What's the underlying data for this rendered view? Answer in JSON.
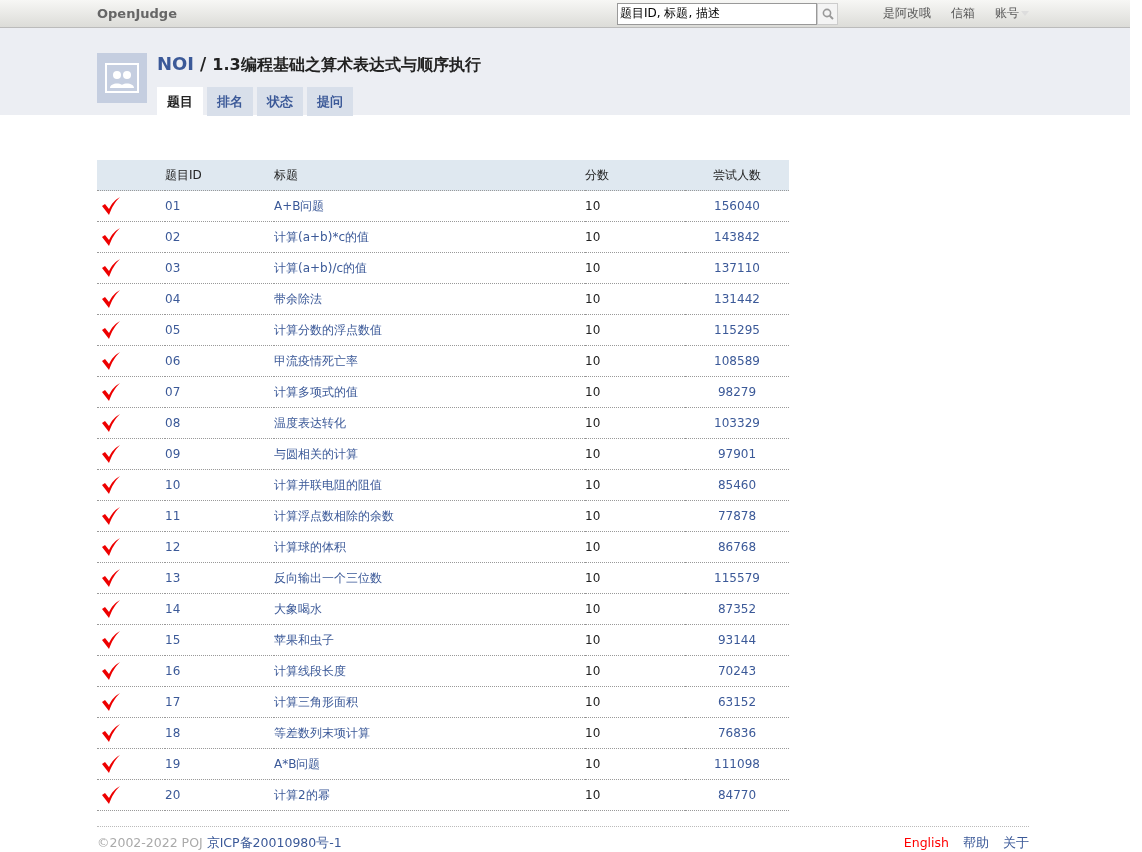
{
  "topbar": {
    "brand": "OpenJudge",
    "search": {
      "value": "题目ID, 标题, 描述"
    },
    "links": [
      {
        "label": "是阿改哦"
      },
      {
        "label": "信箱"
      },
      {
        "label": "账号",
        "dropdown": true
      }
    ]
  },
  "header": {
    "group": "NOI",
    "separator": "/",
    "title": "1.3编程基础之算术表达式与顺序执行",
    "tabs": [
      {
        "label": "题目",
        "selected": true
      },
      {
        "label": "排名",
        "selected": false
      },
      {
        "label": "状态",
        "selected": false
      },
      {
        "label": "提问",
        "selected": false
      }
    ]
  },
  "table": {
    "columns": [
      "题目ID",
      "标题",
      "分数",
      "尝试人数"
    ],
    "rows": [
      {
        "solved": true,
        "id": "01",
        "title": "A+B问题",
        "score": "10",
        "attempts": "156040"
      },
      {
        "solved": true,
        "id": "02",
        "title": "计算(a+b)*c的值",
        "score": "10",
        "attempts": "143842"
      },
      {
        "solved": true,
        "id": "03",
        "title": "计算(a+b)/c的值",
        "score": "10",
        "attempts": "137110"
      },
      {
        "solved": true,
        "id": "04",
        "title": "带余除法",
        "score": "10",
        "attempts": "131442"
      },
      {
        "solved": true,
        "id": "05",
        "title": "计算分数的浮点数值",
        "score": "10",
        "attempts": "115295"
      },
      {
        "solved": true,
        "id": "06",
        "title": "甲流疫情死亡率",
        "score": "10",
        "attempts": "108589"
      },
      {
        "solved": true,
        "id": "07",
        "title": "计算多项式的值",
        "score": "10",
        "attempts": "98279"
      },
      {
        "solved": true,
        "id": "08",
        "title": "温度表达转化",
        "score": "10",
        "attempts": "103329"
      },
      {
        "solved": true,
        "id": "09",
        "title": "与圆相关的计算",
        "score": "10",
        "attempts": "97901"
      },
      {
        "solved": true,
        "id": "10",
        "title": "计算并联电阻的阻值",
        "score": "10",
        "attempts": "85460"
      },
      {
        "solved": true,
        "id": "11",
        "title": "计算浮点数相除的余数",
        "score": "10",
        "attempts": "77878"
      },
      {
        "solved": true,
        "id": "12",
        "title": "计算球的体积",
        "score": "10",
        "attempts": "86768"
      },
      {
        "solved": true,
        "id": "13",
        "title": "反向输出一个三位数",
        "score": "10",
        "attempts": "115579"
      },
      {
        "solved": true,
        "id": "14",
        "title": "大象喝水",
        "score": "10",
        "attempts": "87352"
      },
      {
        "solved": true,
        "id": "15",
        "title": "苹果和虫子",
        "score": "10",
        "attempts": "93144"
      },
      {
        "solved": true,
        "id": "16",
        "title": "计算线段长度",
        "score": "10",
        "attempts": "70243"
      },
      {
        "solved": true,
        "id": "17",
        "title": "计算三角形面积",
        "score": "10",
        "attempts": "63152"
      },
      {
        "solved": true,
        "id": "18",
        "title": "等差数列末项计算",
        "score": "10",
        "attempts": "76836"
      },
      {
        "solved": true,
        "id": "19",
        "title": "A*B问题",
        "score": "10",
        "attempts": "111098"
      },
      {
        "solved": true,
        "id": "20",
        "title": "计算2的幂",
        "score": "10",
        "attempts": "84770"
      }
    ]
  },
  "footer": {
    "copyright": "©2002-2022 POJ",
    "icp": "京ICP备20010980号-1",
    "links": [
      {
        "label": "English",
        "color": "#ff0000"
      },
      {
        "label": "帮助",
        "color": "#3b5998"
      },
      {
        "label": "关于",
        "color": "#3b5998"
      }
    ]
  }
}
